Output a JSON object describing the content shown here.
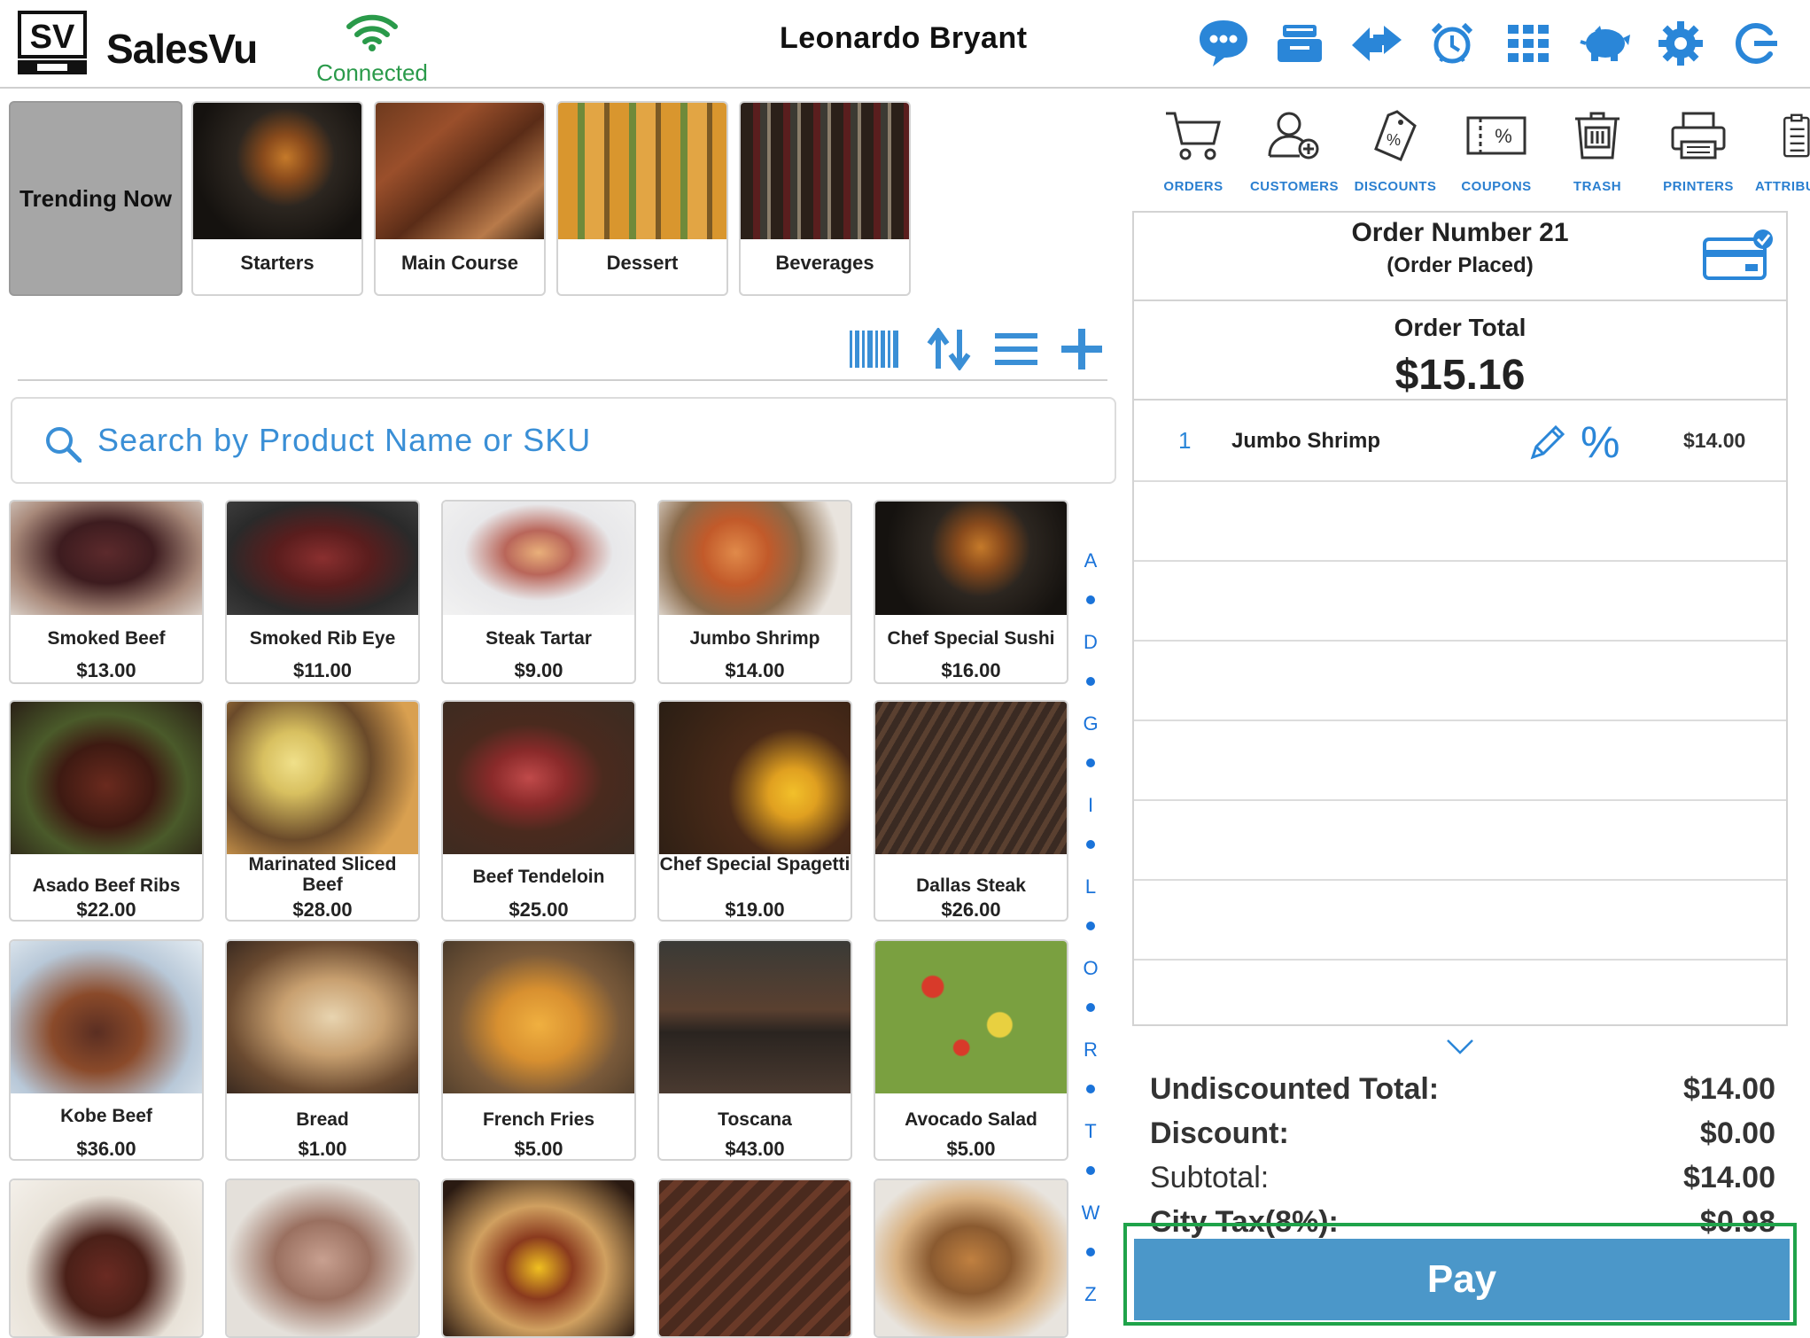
{
  "app": {
    "brand": "SalesVu",
    "logo_text": "SV"
  },
  "connection": {
    "label": "Connected"
  },
  "user": {
    "name": "Leonardo Bryant"
  },
  "top_icons": [
    "chat-icon",
    "cash-drawer-icon",
    "transfer-icon",
    "alarm-clock-icon",
    "grid-icon",
    "piggy-bank-icon",
    "gear-icon",
    "logout-icon"
  ],
  "colors": {
    "accent": "#1a73d9",
    "pay": "#4b97c9",
    "connected": "#2a9a4a",
    "highlight": "#1fa34a",
    "tile_gray": "#a6a6a6"
  },
  "categories": {
    "trending": "Trending Now",
    "items": [
      "Starters",
      "Main Course",
      "Dessert",
      "Beverages"
    ]
  },
  "search": {
    "placeholder": "Search by Product Name or SKU"
  },
  "products": [
    {
      "name": "Smoked Beef",
      "price": "$13.00"
    },
    {
      "name": "Smoked Rib Eye",
      "price": "$11.00"
    },
    {
      "name": "Steak Tartar",
      "price": "$9.00"
    },
    {
      "name": "Jumbo Shrimp",
      "price": "$14.00"
    },
    {
      "name": "Chef Special Sushi",
      "price": "$16.00"
    },
    {
      "name": "Asado Beef Ribs",
      "price": "$22.00"
    },
    {
      "name": "Marinated Sliced Beef",
      "price": "$28.00"
    },
    {
      "name": "Beef Tendeloin",
      "price": "$25.00"
    },
    {
      "name": "Chef Special Spagetti",
      "price": "$19.00"
    },
    {
      "name": "Dallas Steak",
      "price": "$26.00"
    },
    {
      "name": "Kobe Beef",
      "price": "$36.00"
    },
    {
      "name": "Bread",
      "price": "$1.00"
    },
    {
      "name": "French Fries",
      "price": "$5.00"
    },
    {
      "name": "Toscana",
      "price": "$43.00"
    },
    {
      "name": "Avocado Salad",
      "price": "$5.00"
    }
  ],
  "alphabet": [
    "A",
    "D",
    "G",
    "I",
    "L",
    "O",
    "R",
    "T",
    "W",
    "Z"
  ],
  "actions": [
    "ORDERS",
    "CUSTOMERS",
    "DISCOUNTS",
    "COUPONS",
    "TRASH",
    "PRINTERS",
    "ATTRIBU"
  ],
  "order": {
    "title": "Order Number 21",
    "status": "(Order Placed)",
    "total_label": "Order Total",
    "total": "$15.16",
    "lines": [
      {
        "qty": "1",
        "name": "Jumbo Shrimp",
        "price": "$14.00"
      }
    ]
  },
  "summary": {
    "undiscounted_label": "Undiscounted Total:",
    "undiscounted": "$14.00",
    "discount_label": "Discount:",
    "discount": "$0.00",
    "subtotal_label": "Subtotal:",
    "subtotal": "$14.00",
    "tax_label": "City Tax(8%):",
    "tax": "$0.98"
  },
  "pay": {
    "label": "Pay"
  }
}
